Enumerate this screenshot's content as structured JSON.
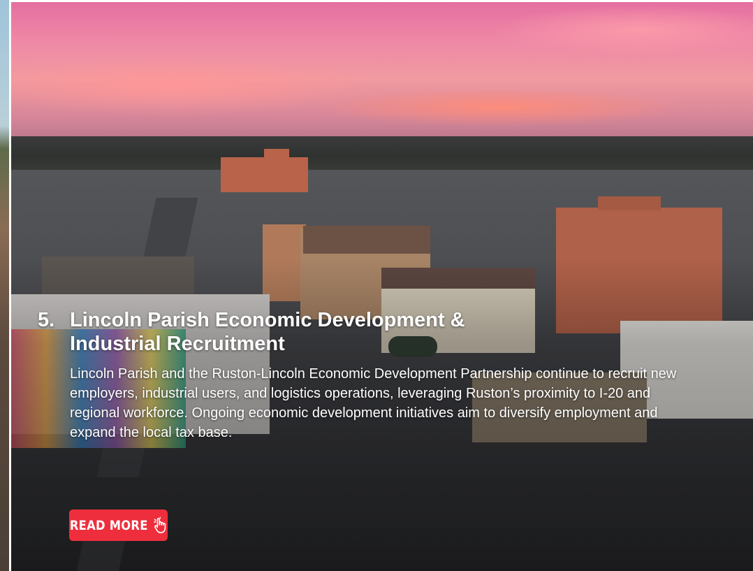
{
  "slide": {
    "number": "5.",
    "title": "Lincoln Parish Economic Development & Industrial Recruitment",
    "body": "Lincoln Parish and the Ruston-Lincoln Economic Development Partnership continue to recruit new employers, industrial users, and logistics operations, leveraging Ruston’s proximity to I-20 and regional workforce. Ongoing economic development initiatives aim to diversify employment and expand the local tax base.",
    "cta_label": "READ MORE",
    "cta_icon": "hand-pointer-icon",
    "background": "aerial-town-sunset-photo"
  },
  "colors": {
    "cta_background": "#ee2e3c",
    "text": "#ffffff"
  }
}
